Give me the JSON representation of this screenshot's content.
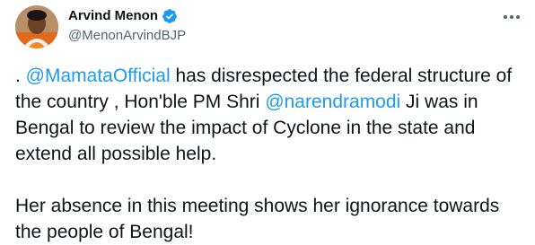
{
  "author": {
    "display_name": "Arvind Menon",
    "handle": "@MenonArvindBJP",
    "verified": true
  },
  "tweet": {
    "p1_prefix": ". ",
    "mention1": "@MamataOfficial",
    "p1_middle": " has disrespected the federal structure of the country , Hon'ble PM Shri ",
    "mention2": "@narendramodi",
    "p1_suffix": " Ji was in Bengal to review the impact of Cyclone in the state and extend all possible help.",
    "p2": "Her absence in this meeting shows her ignorance towards the people of Bengal!"
  },
  "icons": {
    "verified": "verified-badge-icon",
    "more": "more-options-icon"
  },
  "colors": {
    "accent": "#1d9bf0",
    "text": "#0f1419",
    "secondary": "#536471"
  }
}
